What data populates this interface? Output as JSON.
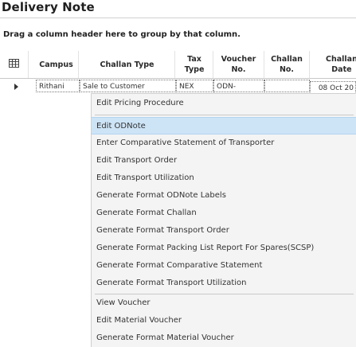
{
  "page": {
    "title": "Delivery Note"
  },
  "grid": {
    "group_hint": "Drag a column header here to group by that column.",
    "columns": [
      "Campus",
      "Challan Type",
      "Tax\nType",
      "Voucher\nNo.",
      "Challan\nNo.",
      "Challan\nDate"
    ],
    "row": {
      "campus": "Rithani",
      "challan_type": "Sale to Customer",
      "tax_type": "NEX",
      "voucher_no": "ODN-",
      "challan_no": "",
      "challan_date": "08 Oct 20"
    }
  },
  "context_menu": {
    "items": [
      "Edit Pricing Procedure",
      "Edit ODNote",
      "Enter Comparative Statement of Transporter",
      "Edit Transport Order",
      "Edit Transport Utilization",
      "Generate Format ODNote Labels",
      "Generate Format Challan",
      "Generate Format Transport Order",
      "Generate Format Packing List Report For Spares(SCSP)",
      "Generate Format Comparative Statement",
      "Generate Format Transport Utilization",
      "View Voucher",
      "Edit Material Voucher",
      "Generate Format Material Voucher"
    ],
    "highlighted_index": 1
  },
  "icons": {
    "column_chooser": "column-chooser-icon",
    "row_indicator": "row-pointer-icon"
  },
  "colors": {
    "highlight": "#cde4f7",
    "menu_bg": "#f4f4f4"
  }
}
